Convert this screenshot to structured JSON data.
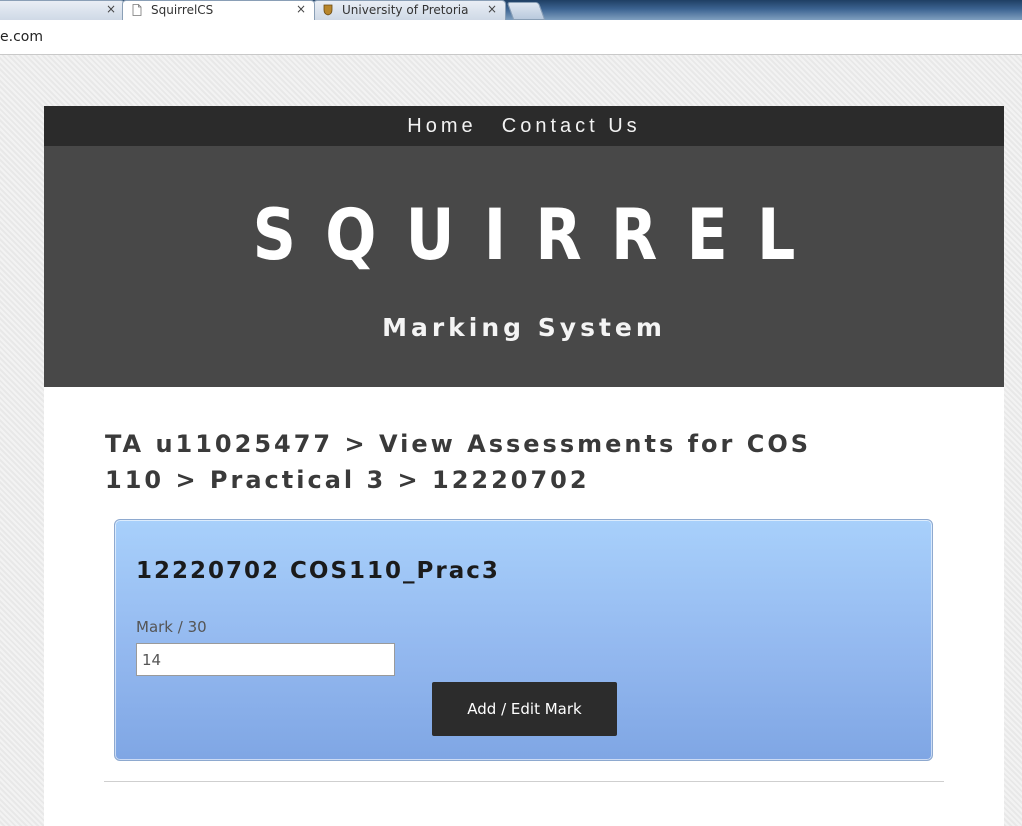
{
  "browser": {
    "tabs": [
      {
        "label": "",
        "close": "×"
      },
      {
        "label": "SquirrelCS",
        "close": "×"
      },
      {
        "label": "University of Pretoria - De",
        "close": "×"
      }
    ],
    "url": "e.com"
  },
  "nav": {
    "home": "Home",
    "contact": "Contact Us"
  },
  "hero": {
    "brand": "SQUIRREL",
    "tagline": "Marking System"
  },
  "breadcrumb": "TA u11025477 > View Assessments for COS 110 > Practical 3 > 12220702",
  "panel": {
    "title": "12220702 COS110_Prac3",
    "mark_label": "Mark / 30",
    "mark_value": "14",
    "button": "Add / Edit Mark"
  },
  "colors": {
    "nav_bg": "#2b2b2b",
    "hero_bg": "#484848",
    "panel_top": "#a8d0fb",
    "panel_bottom": "#7fa6e4",
    "button_bg": "#2c2c2c"
  }
}
